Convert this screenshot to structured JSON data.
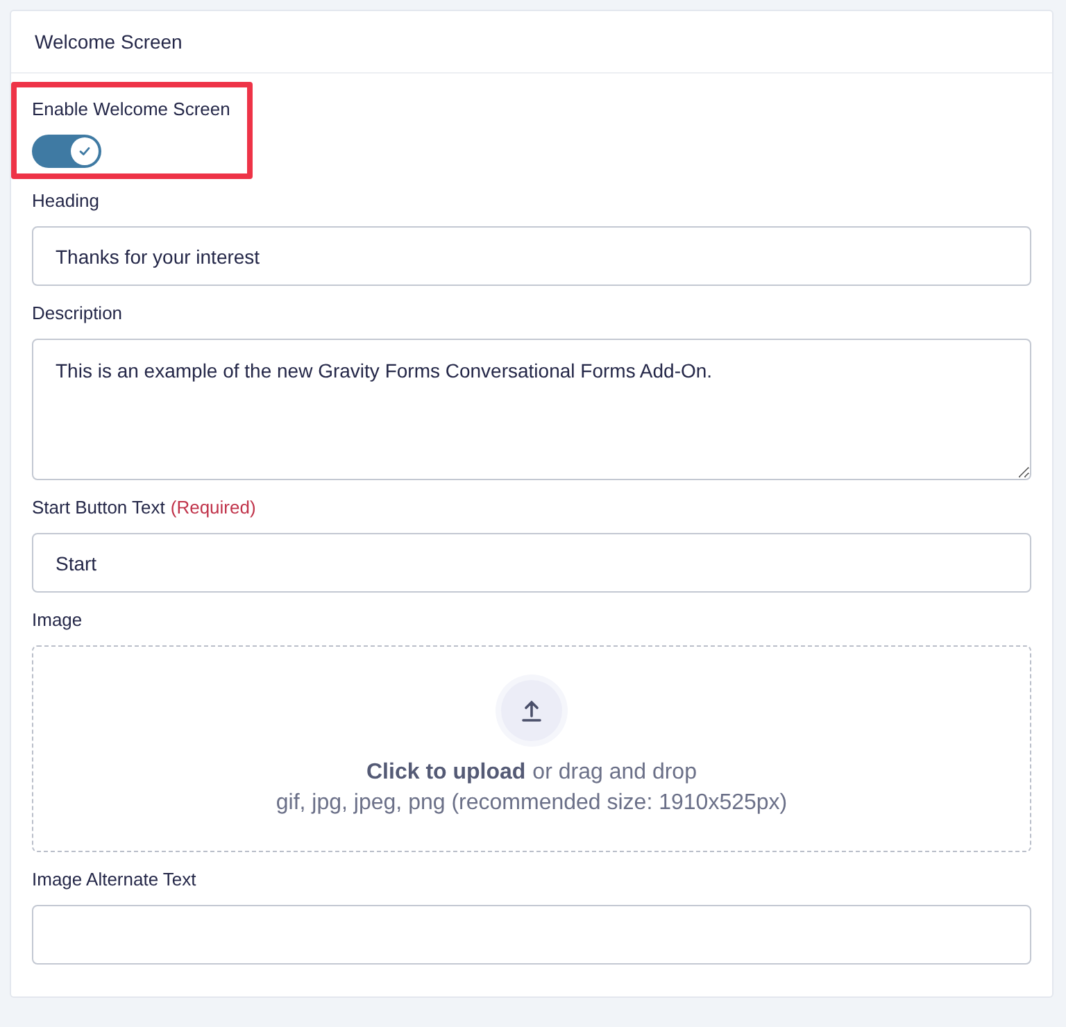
{
  "panel": {
    "title": "Welcome Screen"
  },
  "fields": [
    {
      "kind": "toggle",
      "label": "Enable Welcome Screen",
      "on": true,
      "highlighted": true
    },
    {
      "kind": "text",
      "label": "Heading",
      "value": "Thanks for your interest"
    },
    {
      "kind": "textarea",
      "label": "Description",
      "value": "This is an example of the new Gravity Forms Conversational Forms Add-On."
    },
    {
      "kind": "text",
      "label": "Start Button Text",
      "required_note": "(Required)",
      "value": "Start"
    },
    {
      "kind": "upload",
      "label": "Image",
      "link": "Click to upload",
      "hint": "or drag and drop",
      "formats": "gif, jpg, jpeg, png (recommended size: 1910x525px)"
    },
    {
      "kind": "text",
      "label": "Image Alternate Text"
    }
  ]
}
